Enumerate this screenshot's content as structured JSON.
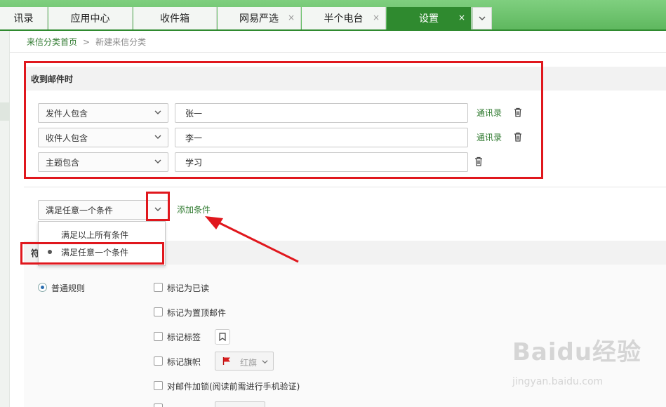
{
  "tabs": [
    {
      "label": "讯录",
      "closable": false,
      "active": false
    },
    {
      "label": "应用中心",
      "closable": false,
      "active": false
    },
    {
      "label": "收件箱",
      "closable": false,
      "active": false
    },
    {
      "label": "网易严选",
      "closable": true,
      "active": false
    },
    {
      "label": "半个电台",
      "closable": true,
      "active": false
    },
    {
      "label": "设置",
      "closable": true,
      "active": true
    }
  ],
  "tab_close_glyph": "×",
  "breadcrumb": {
    "home": "来信分类首页",
    "separator": ">",
    "current": "新建来信分类"
  },
  "section": {
    "title": "收到邮件时"
  },
  "conditions": [
    {
      "field": "发件人包含",
      "value": "张一",
      "contacts": "通讯录"
    },
    {
      "field": "收件人包含",
      "value": "李一",
      "contacts": "通讯录"
    },
    {
      "field": "主题包含",
      "value": "学习",
      "contacts": ""
    }
  ],
  "match_mode": {
    "selected": "满足任意一个条件",
    "add_label": "添加条件"
  },
  "dropdown_options": [
    "满足以上所有条件",
    "满足任意一个条件"
  ],
  "section2": {
    "title_partial": "符"
  },
  "rule_type": {
    "label": "普通规则"
  },
  "actions": [
    "标记为已读",
    "标记为置顶邮件",
    "标记标签",
    "标记旗帜",
    "对邮件加锁(阅读前需进行手机验证)"
  ],
  "flag": {
    "label": "红旗",
    "color": "#d81e1e"
  },
  "watermark": {
    "main": "Baidu经验",
    "sub": "jingyan.baidu.com"
  },
  "colors": {
    "brand_green": "#2f8a2f",
    "link_green": "#2f7a2f",
    "annotation_red": "#e0171d"
  },
  "icons": {
    "tab_more": "chevron-down-icon",
    "trash": "trash-icon",
    "tag": "bookmark-icon",
    "flag": "flag-icon"
  }
}
